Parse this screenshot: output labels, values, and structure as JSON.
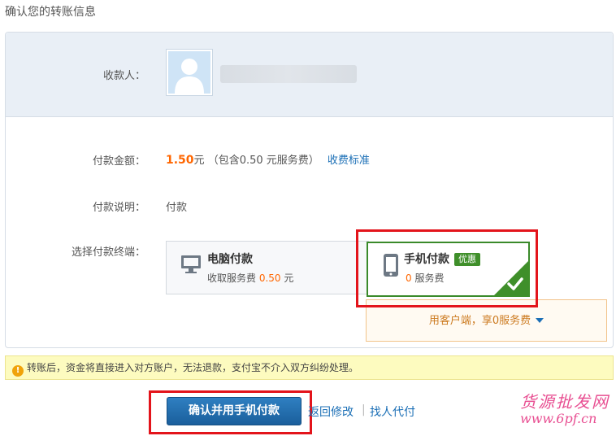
{
  "page": {
    "title": "确认您的转账信息"
  },
  "payee": {
    "label": "收款人："
  },
  "amount": {
    "label": "付款金额：",
    "value": "1.50",
    "unit": "元",
    "fee_prefix": "（包含0.50 元服务费）",
    "fee_link": "收费标准"
  },
  "description": {
    "label": "付款说明：",
    "value": "付款"
  },
  "terminal": {
    "label": "选择付款终端：",
    "pc": {
      "title": "电脑付款",
      "fee_prefix": "收取服务费",
      "fee_value": "0.50",
      "fee_unit": "元",
      "icon": "monitor-icon"
    },
    "mobile": {
      "title": "手机付款",
      "badge": "优惠",
      "fee_value": "0",
      "fee_suffix": "服务费",
      "icon": "phone-icon",
      "selected": true
    },
    "client_tip": "用客户端，享0服务费"
  },
  "warning": {
    "text": "转账后，资金将直接进入对方账户，无法退款，支付宝不介入双方纠纷处理。"
  },
  "actions": {
    "confirm_label": "确认并用手机付款",
    "back_label": "返回修改",
    "agent_label": "找人代付"
  },
  "watermark": {
    "cn": "货源批发网",
    "url": "www.6pf.cn"
  },
  "colors": {
    "accent_orange": "#ff6600",
    "link_blue": "#1b6fb6",
    "selected_green": "#3f8f2a",
    "highlight_red": "#e3141b"
  }
}
